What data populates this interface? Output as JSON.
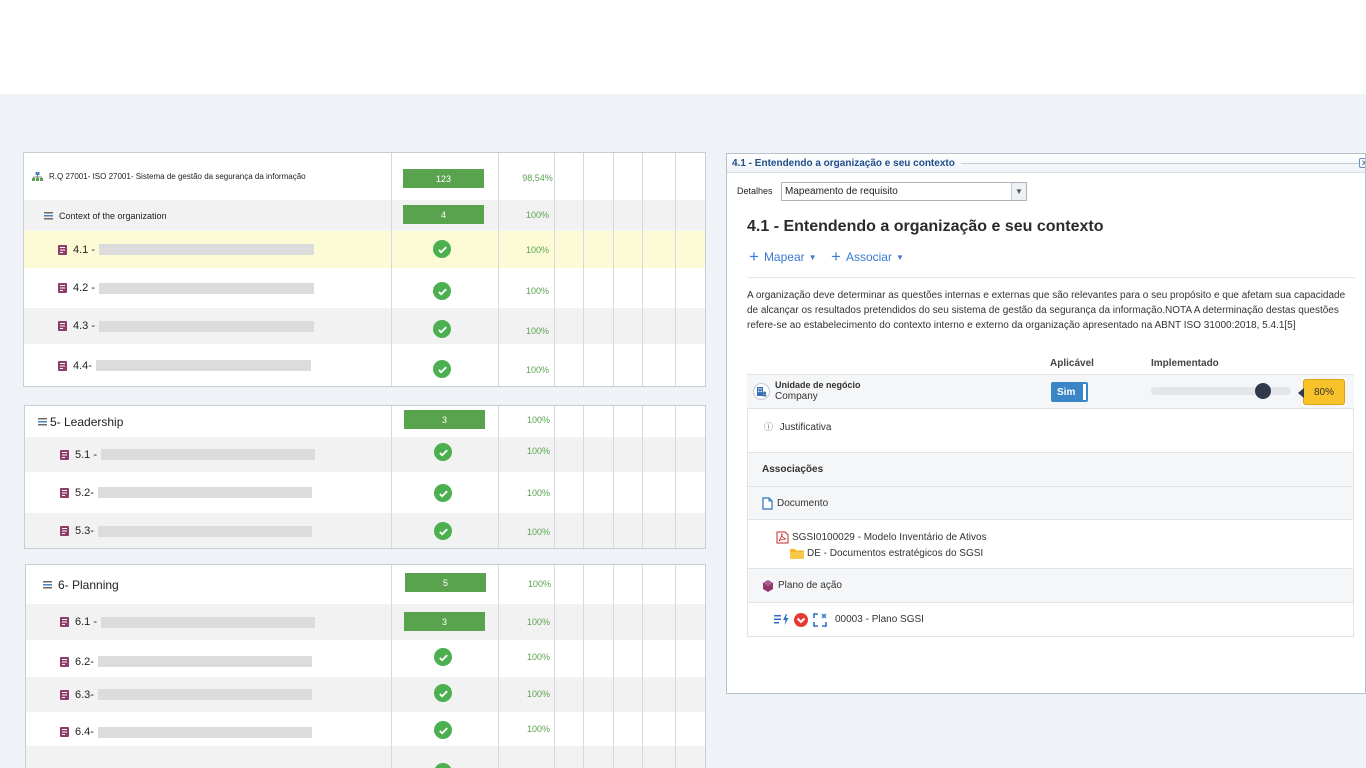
{
  "left": {
    "panel1": {
      "header": {
        "label": "R.Q 27001- ISO 27001- Sistema de gestão da segurança da informação",
        "count": "123",
        "pct": "98,54%"
      },
      "group": {
        "label": "Context of the organization",
        "count": "4",
        "pct": "100%"
      },
      "items": [
        {
          "label": "4.1 -",
          "pct": "100%"
        },
        {
          "label": "4.2 -",
          "pct": "100%"
        },
        {
          "label": "4.3 -",
          "pct": "100%"
        },
        {
          "label": "4.4-",
          "pct": "100%"
        }
      ]
    },
    "panel2": {
      "group": {
        "label": "5- Leadership",
        "count": "3",
        "pct": "100%"
      },
      "items": [
        {
          "label": "5.1 -",
          "pct": "100%"
        },
        {
          "label": "5.2-",
          "pct": "100%"
        },
        {
          "label": "5.3-",
          "pct": "100%"
        }
      ]
    },
    "panel3": {
      "group": {
        "label": "6- Planning",
        "count": "5",
        "pct": "100%"
      },
      "items": [
        {
          "label": "6.1 -",
          "count": "3",
          "pct": "100%"
        },
        {
          "label": "6.2-",
          "pct": "100%"
        },
        {
          "label": "6.3-",
          "pct": "100%"
        },
        {
          "label": "6.4-",
          "pct": "100%"
        }
      ]
    }
  },
  "detail": {
    "window_title": "4.1 - Entendendo a organização e seu contexto",
    "close": "x",
    "details_label": "Detalhes",
    "details_value": "Mapeamento de requisito",
    "heading": "4.1 - Entendendo a organização e seu contexto",
    "map_label": "Mapear",
    "associate_label": "Associar",
    "description": "A organização deve determinar as questões internas e externas que são relevantes para o seu propósito e que afetam sua capacidade de alcançar os resultados pretendidos do seu sistema de gestão da segurança da informação.NOTA A determinação destas questões refere-se ao estabelecimento do contexto interno e externo da organização apresentado na ABNT ISO 31000:2018, 5.4.1[5]",
    "col_applicable": "Aplicável",
    "col_implemented": "Implementado",
    "business_unit_label": "Unidade de negócio",
    "business_unit_value": "Company",
    "applicable_value": "Sim",
    "implemented_pct": 80,
    "implemented_text": "80%",
    "justification": "Justificativa",
    "associations": "Associações",
    "document_header": "Documento",
    "document_name": "SGSI0100029 - Modelo Inventário de Ativos",
    "document_folder": "DE - Documentos estratégicos do SGSI",
    "action_plan_header": "Plano de ação",
    "action_plan_item": "00003 - Plano SGSI"
  },
  "colors": {
    "accent": "#3a7bd5",
    "success": "#4caf50",
    "badge": "#5aa34e",
    "tooltip": "#f8c22a"
  }
}
